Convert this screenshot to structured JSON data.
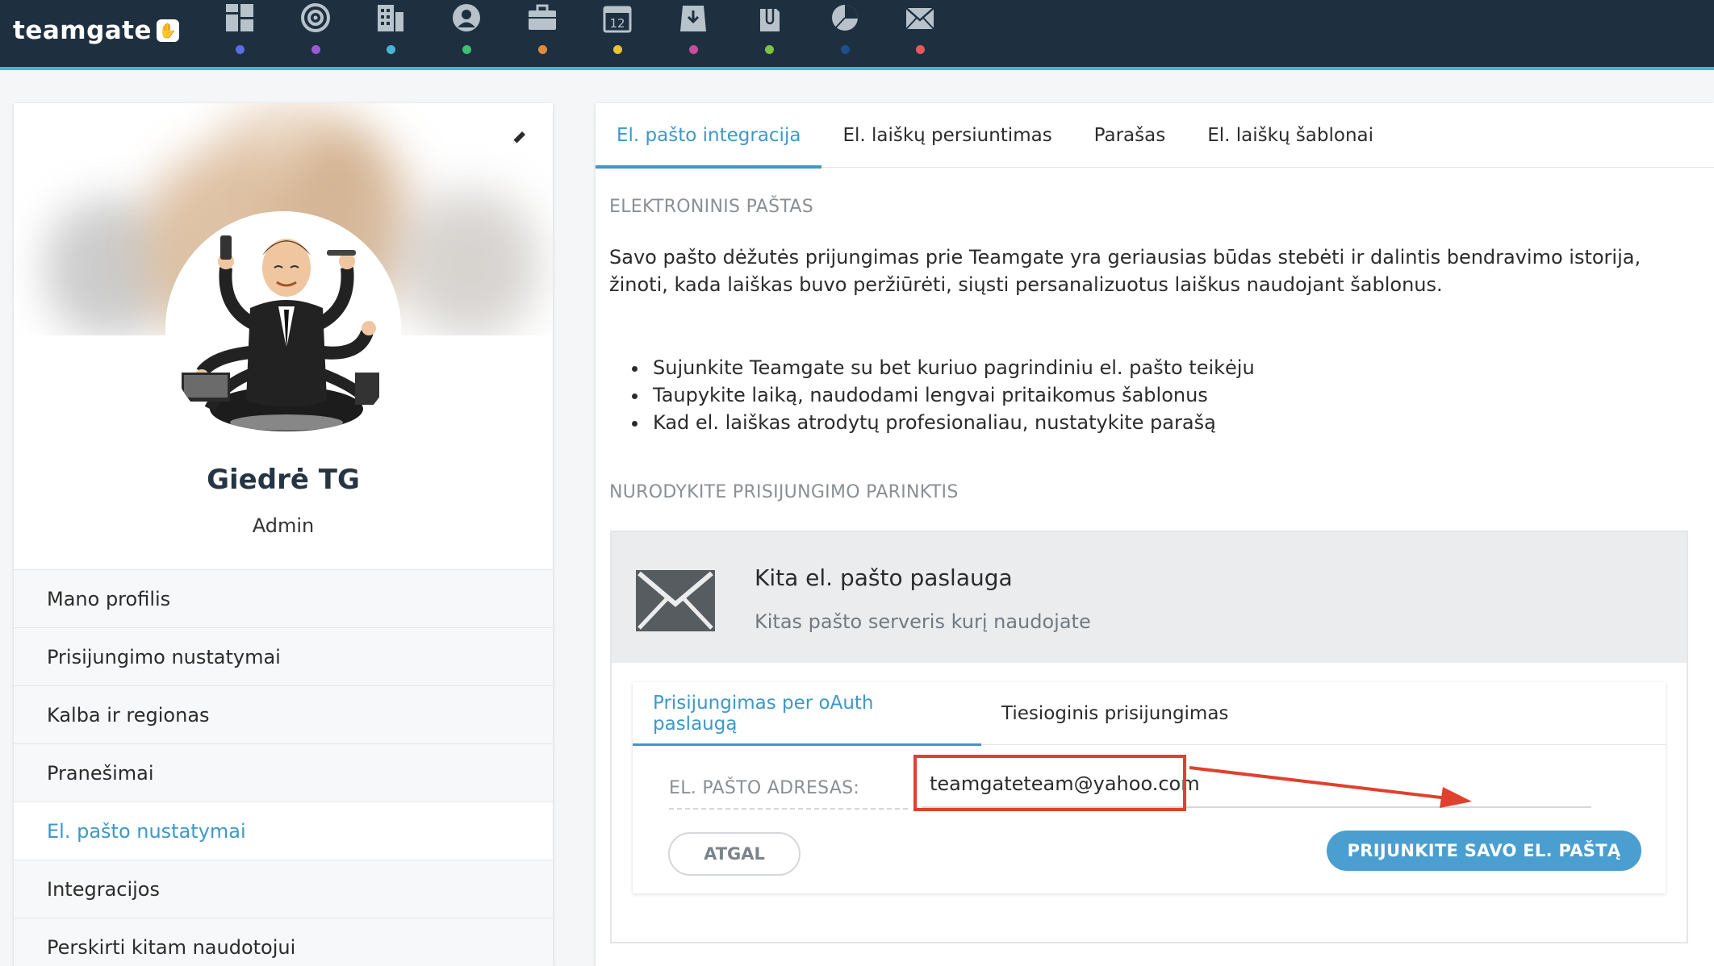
{
  "app": {
    "logo_text": "teamgate"
  },
  "nav": {
    "items": [
      {
        "icon": "dashboard-icon",
        "dot_color": "#5b6ee1"
      },
      {
        "icon": "target-icon",
        "dot_color": "#9b59d8"
      },
      {
        "icon": "companies-icon",
        "dot_color": "#4ab3d8"
      },
      {
        "icon": "contacts-icon",
        "dot_color": "#3fbf6f"
      },
      {
        "icon": "deals-icon",
        "dot_color": "#e08a3c"
      },
      {
        "icon": "calendar-icon",
        "dot_color": "#e6c23a",
        "label": "12"
      },
      {
        "icon": "inbox-download-icon",
        "dot_color": "#c84b9e"
      },
      {
        "icon": "attachment-icon",
        "dot_color": "#7dc242"
      },
      {
        "icon": "reports-pie-icon",
        "dot_color": "#1d4f8f"
      },
      {
        "icon": "mail-icon",
        "dot_color": "#e85a5a"
      }
    ]
  },
  "profile": {
    "name": "Giedrė TG",
    "role": "Admin",
    "menu": [
      {
        "label": "Mano profilis",
        "active": false
      },
      {
        "label": "Prisijungimo nustatymai",
        "active": false
      },
      {
        "label": "Kalba ir regionas",
        "active": false
      },
      {
        "label": "Pranešimai",
        "active": false
      },
      {
        "label": "El. pašto nustatymai",
        "active": true
      },
      {
        "label": "Integracijos",
        "active": false
      },
      {
        "label": "Perskirti kitam naudotojui",
        "active": false
      }
    ]
  },
  "main": {
    "tabs": [
      {
        "label": "El. pašto integracija",
        "active": true
      },
      {
        "label": "El. laiškų persiuntimas",
        "active": false
      },
      {
        "label": "Parašas",
        "active": false
      },
      {
        "label": "El. laiškų šablonai",
        "active": false
      }
    ],
    "section1_title": "ELEKTRONINIS PAŠTAS",
    "intro_text": "Savo pašto dėžutės prijungimas prie Teamgate yra geriausias būdas stebėti ir dalintis bendravimo istorija, žinoti, kada laiškas buvo peržiūrėti, siųsti persanalizuotus laiškus naudojant šablonus.",
    "bullets": [
      "Sujunkite Teamgate su bet kuriuo pagrindiniu el. pašto teikėju",
      "Taupykite laiką, naudodami lengvai pritaikomus šablonus",
      "Kad el. laiškas atrodytų profesionaliau, nustatykite parašą"
    ],
    "section2_title": "NURODYKITE PRISIJUNGIMO PARINKTIS",
    "service": {
      "name": "Kita el. pašto paslauga",
      "description": "Kitas pašto serveris kurį naudojate"
    },
    "connection_tabs": [
      {
        "label": "Prisijungimas per oAuth paslaugą",
        "active": true
      },
      {
        "label": "Tiesioginis prisijungimas",
        "active": false
      }
    ],
    "email_field": {
      "label": "EL. PAŠTO ADRESAS:",
      "value": "teamgateteam@yahoo.com"
    },
    "back_button": "ATGAL",
    "connect_button": "PRIJUNKITE SAVO EL. PAŠTĄ",
    "annotation_color": "#e0402e"
  }
}
